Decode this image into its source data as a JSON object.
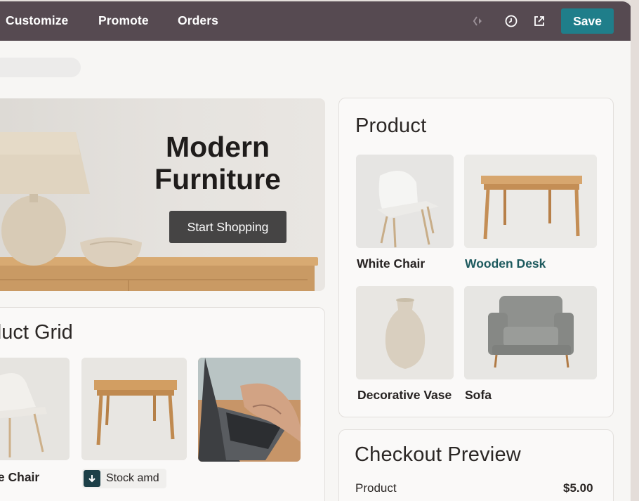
{
  "topbar": {
    "nav": [
      "Customize",
      "Promote",
      "Orders"
    ],
    "icons": [
      "mobile-preview-icon",
      "history-icon",
      "open-external-icon"
    ],
    "save_label": "Save"
  },
  "colors": {
    "topbar": "#564a51",
    "save": "#1f7e8a",
    "accent_text": "#1d5a5e",
    "hero_button": "#454444"
  },
  "hero": {
    "title_line1": "Modern",
    "title_line2": "Furniture",
    "button_label": "Start Shopping"
  },
  "product_grid": {
    "title": "Product Grid",
    "items": [
      {
        "label": "White Chair"
      },
      {
        "label": ""
      },
      {
        "label": ""
      }
    ],
    "stock_badge": "Stock amd"
  },
  "product_card": {
    "title": "Product",
    "items": [
      {
        "label": "White Chair",
        "highlighted": false
      },
      {
        "label": "Wooden Desk",
        "highlighted": true
      },
      {
        "label": "Decorative Vase",
        "highlighted": false
      },
      {
        "label": "Sofa",
        "highlighted": false
      }
    ]
  },
  "checkout": {
    "title": "Checkout Preview",
    "rows": [
      {
        "label": "Product",
        "price": "$5.00"
      }
    ]
  }
}
